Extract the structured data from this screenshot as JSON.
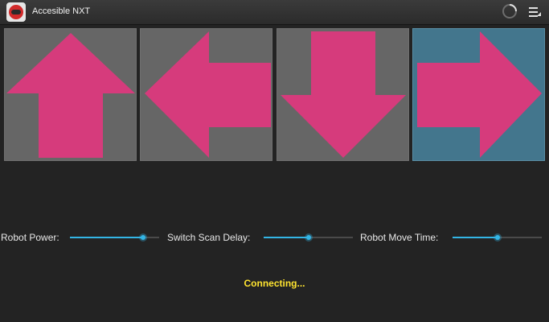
{
  "app": {
    "title": "Accesible NXT"
  },
  "icons": {
    "app": "robot-app-icon",
    "progress": "loading-spinner-icon",
    "menu": "overflow-menu-icon"
  },
  "colors": {
    "arrow": "#d63b7c",
    "tile": "#666666",
    "tile_selected": "#43768d",
    "slider": "#33b5e5",
    "status": "#ffe430"
  },
  "controls": {
    "selected": "right",
    "buttons": [
      {
        "id": "up",
        "icon": "arrow-up-icon"
      },
      {
        "id": "left",
        "icon": "arrow-left-icon"
      },
      {
        "id": "down",
        "icon": "arrow-down-icon"
      },
      {
        "id": "right",
        "icon": "arrow-right-icon"
      }
    ]
  },
  "sliders": [
    {
      "label": "Robot Power:",
      "level": 0.82
    },
    {
      "label": "Switch Scan Delay:",
      "level": 0.5
    },
    {
      "label": "Robot Move Time:",
      "level": 0.5
    }
  ],
  "status": {
    "text": "Connecting..."
  }
}
